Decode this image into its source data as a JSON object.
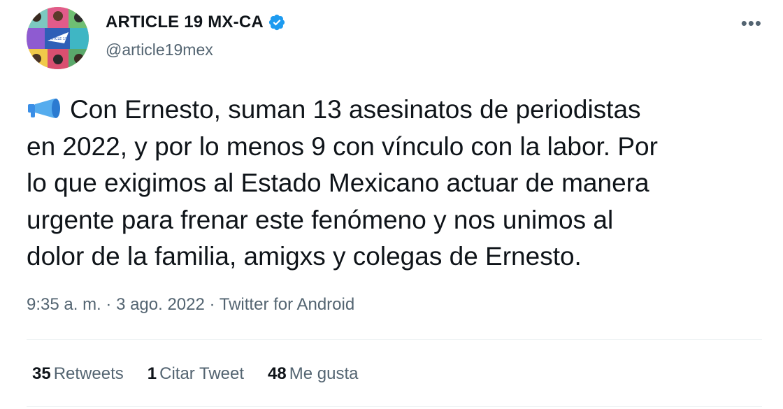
{
  "author": {
    "display_name": "ARTICLE 19 MX-CA",
    "handle": "@article19mex",
    "verified": true,
    "avatar_text": "ARTICLE 19"
  },
  "icons": {
    "verified": "verified-badge-icon",
    "more": "more-options-icon",
    "emoji": "megaphone-icon"
  },
  "colors": {
    "verified_blue": "#1d9bf0",
    "secondary_text": "#536471",
    "primary_text": "#0f1419"
  },
  "tweet": {
    "text": "Con Ernesto, suman 13 asesinatos de periodistas en 2022, y por lo menos 9 con vínculo con la labor. Por lo que exigimos al Estado Mexicano actuar de manera urgente para frenar este fenómeno y nos unimos al dolor de la familia, amigxs y colegas de Ernesto.",
    "lines": [
      "Con Ernesto, suman 13 asesinatos de periodistas",
      "en 2022, y por lo menos 9 con vínculo con la labor. Por",
      "lo que exigimos al Estado Mexicano actuar de manera",
      "urgente para frenar este fenómeno y nos unimos al",
      "dolor de la familia, amigxs y colegas de Ernesto."
    ]
  },
  "meta": {
    "time": "9:35 a. m.",
    "separator": " · ",
    "date": "3 ago. 2022",
    "source": "Twitter for Android"
  },
  "stats": {
    "retweets": {
      "count": "35",
      "label": "Retweets"
    },
    "quotes": {
      "count": "1",
      "label": "Citar Tweet"
    },
    "likes": {
      "count": "48",
      "label": "Me gusta"
    }
  }
}
